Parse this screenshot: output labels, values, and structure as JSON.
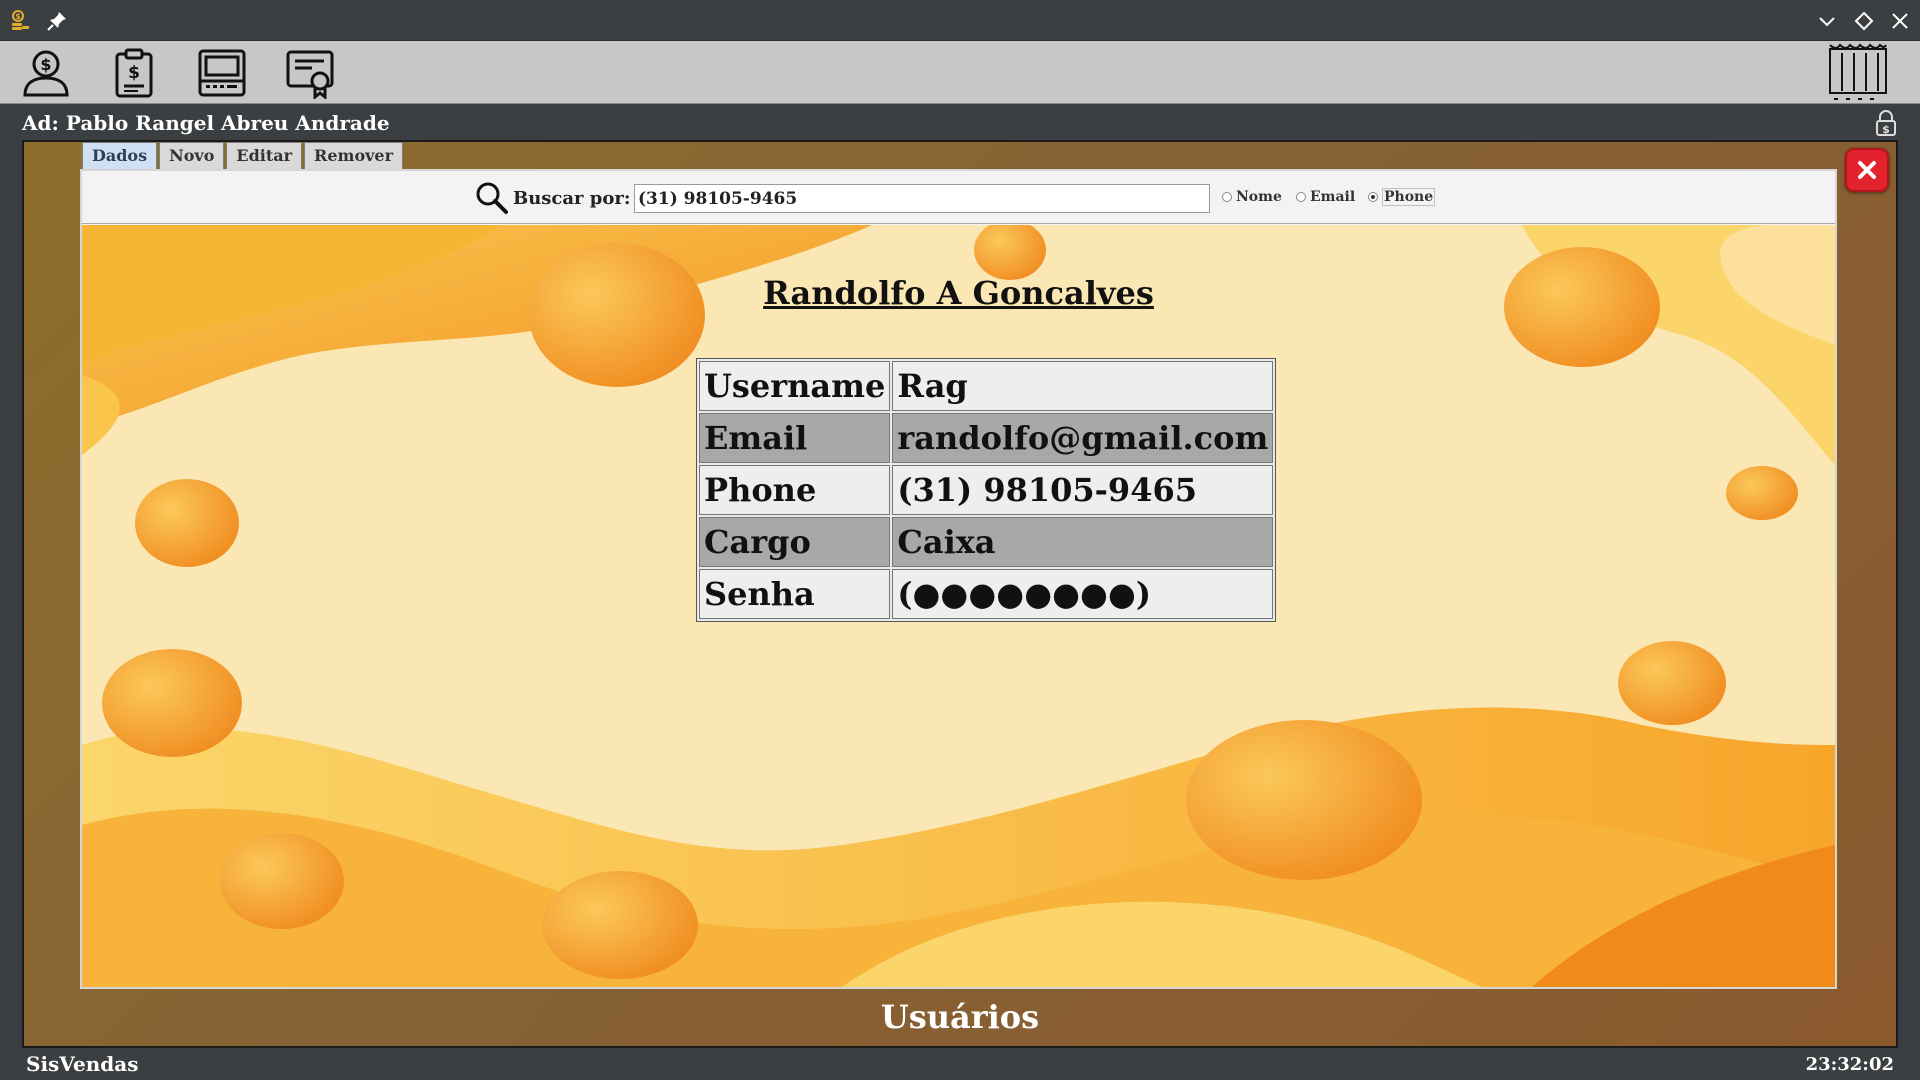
{
  "window": {
    "icons": [
      "app-coins-icon",
      "pin-icon",
      "minimize-icon",
      "maximize-icon",
      "close-icon"
    ]
  },
  "toolbar": {
    "tools": [
      "user-money-icon",
      "clipboard-dollar-icon",
      "cash-register-icon",
      "certificate-icon",
      "building-icon"
    ]
  },
  "admin": {
    "label": "Ad: Pablo Rangel Abreu Andrade"
  },
  "tabs": [
    {
      "label": "Dados",
      "active": true
    },
    {
      "label": "Novo",
      "active": false
    },
    {
      "label": "Editar",
      "active": false
    },
    {
      "label": "Remover",
      "active": false
    }
  ],
  "search": {
    "label": "Buscar por:",
    "value": "(31) 98105-9465",
    "options": [
      {
        "label": "Nome",
        "selected": false
      },
      {
        "label": "Email",
        "selected": false
      },
      {
        "label": "Phone",
        "selected": true
      }
    ]
  },
  "user": {
    "name": "Randolfo A Goncalves",
    "rows": [
      {
        "key": "Username",
        "value": "Rag"
      },
      {
        "key": "Email",
        "value": "randolfo@gmail.com"
      },
      {
        "key": "Phone",
        "value": "(31) 98105-9465"
      },
      {
        "key": "Cargo",
        "value": "Caixa"
      },
      {
        "key": "Senha",
        "value": "(●●●●●●●●)"
      }
    ]
  },
  "footer": {
    "title": "Usuários"
  },
  "status": {
    "app_name": "SisVendas",
    "time": "23:32:02"
  },
  "colors": {
    "accent_close": "#e2222c",
    "frame_brown": "#866235",
    "bg_cream": "#fbe7b4",
    "orange": "#f39a1e"
  }
}
